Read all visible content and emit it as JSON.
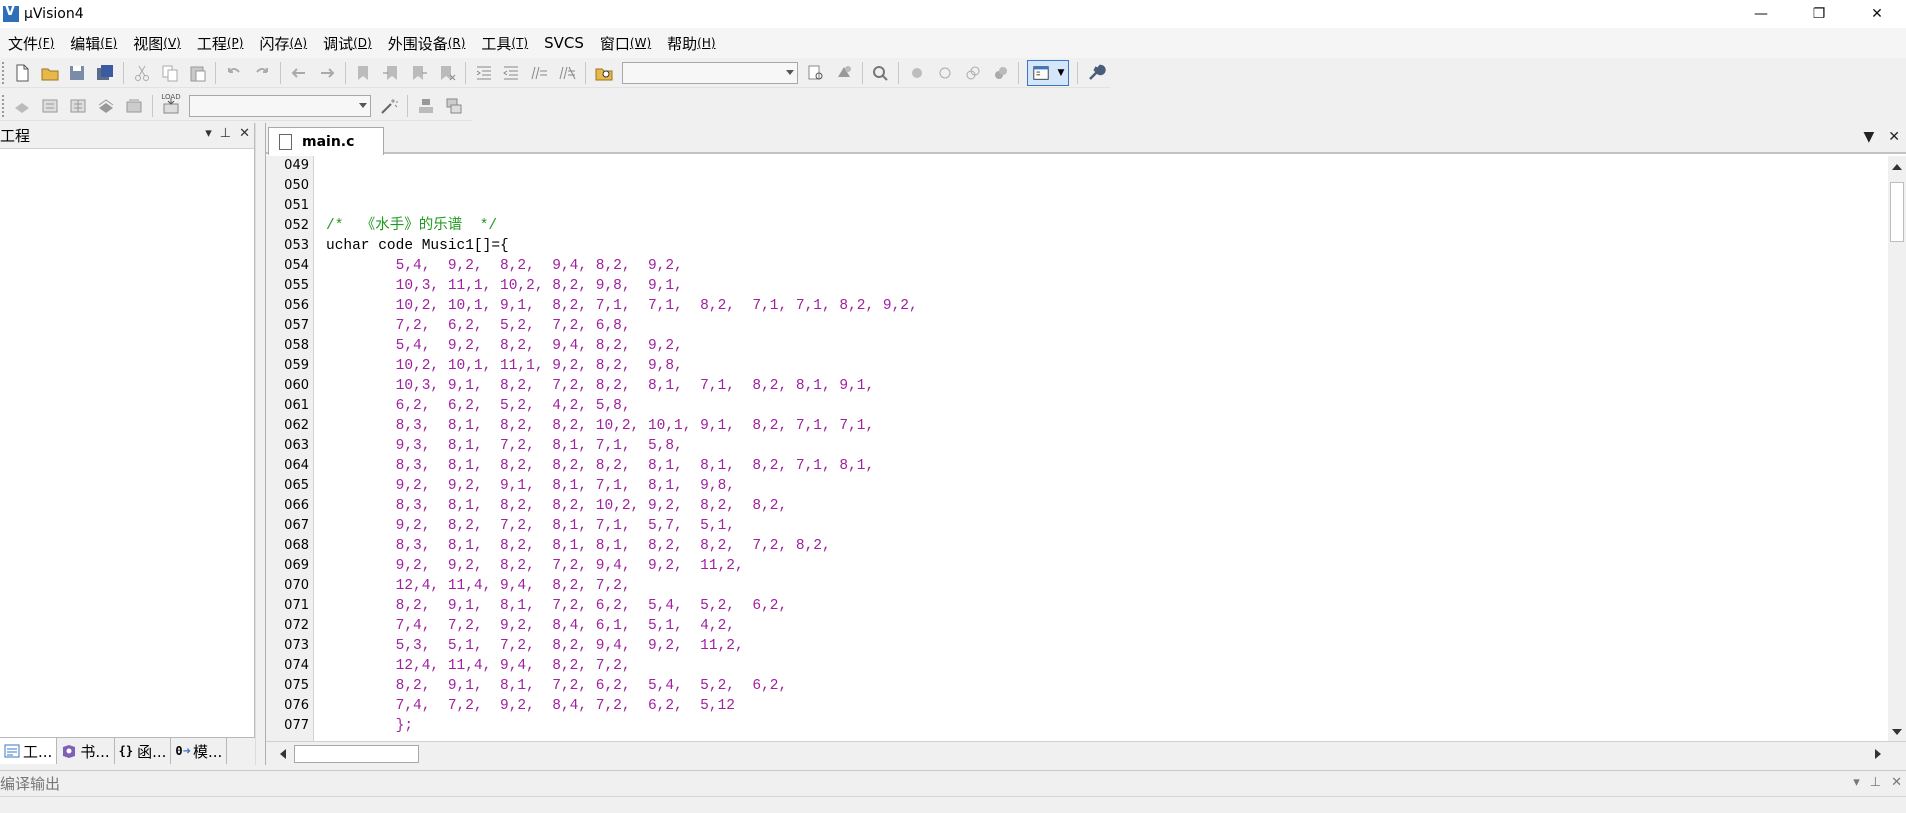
{
  "window": {
    "title": "µVision4",
    "logo_letter": "V",
    "controls": {
      "minimize": "—",
      "maximize": "❐",
      "close": "✕"
    }
  },
  "menu": [
    {
      "label": "文件",
      "accel": "(F)"
    },
    {
      "label": "编辑",
      "accel": "(E)"
    },
    {
      "label": "视图",
      "accel": "(V)"
    },
    {
      "label": "工程",
      "accel": "(P)"
    },
    {
      "label": "闪存",
      "accel": "(A)"
    },
    {
      "label": "调试",
      "accel": "(D)"
    },
    {
      "label": "外围设备",
      "accel": "(R)"
    },
    {
      "label": "工具",
      "accel": "(T)"
    },
    {
      "label": "SVCS",
      "accel": ""
    },
    {
      "label": "窗口",
      "accel": "(W)"
    },
    {
      "label": "帮助",
      "accel": "(H)"
    }
  ],
  "toolbar": {
    "target_combo_value": "",
    "target_select_value": "",
    "load_label": "LOAD"
  },
  "project_panel": {
    "title": "工程",
    "controls": {
      "dropdown": "▾",
      "pin": "⊥",
      "close": "✕"
    },
    "tabs": [
      {
        "label": "工...",
        "icon": "project-icon"
      },
      {
        "label": "书...",
        "icon": "books-icon"
      },
      {
        "label": "函...",
        "icon": "functions-icon",
        "prefix": "{}"
      },
      {
        "label": "模...",
        "icon": "templates-icon",
        "prefix": "0"
      }
    ]
  },
  "editor": {
    "active_file": "main.c",
    "controls": {
      "dropdown": "▼",
      "close": "✕"
    },
    "lines": [
      {
        "no": "049",
        "parts": []
      },
      {
        "no": "050",
        "parts": []
      },
      {
        "no": "051",
        "parts": []
      },
      {
        "no": "052",
        "parts": [
          {
            "t": "/*  《水手》的乐谱  */",
            "c": "cmt"
          }
        ]
      },
      {
        "no": "053",
        "parts": [
          {
            "t": "uchar code Music1[]={",
            "c": "kw"
          }
        ]
      },
      {
        "no": "054",
        "parts": [
          {
            "t": "        5,4,  9,2,  8,2,  9,4, 8,2,  9,2,",
            "c": "num"
          }
        ]
      },
      {
        "no": "055",
        "parts": [
          {
            "t": "        10,3, 11,1, 10,2, 8,2, 9,8,  9,1,",
            "c": "num"
          }
        ]
      },
      {
        "no": "056",
        "parts": [
          {
            "t": "        10,2, 10,1, 9,1,  8,2, 7,1,  7,1,  8,2,  7,1, 7,1, 8,2, 9,2,",
            "c": "num"
          }
        ]
      },
      {
        "no": "057",
        "parts": [
          {
            "t": "        7,2,  6,2,  5,2,  7,2, 6,8,",
            "c": "num"
          }
        ]
      },
      {
        "no": "058",
        "parts": [
          {
            "t": "        5,4,  9,2,  8,2,  9,4, 8,2,  9,2,",
            "c": "num"
          }
        ]
      },
      {
        "no": "059",
        "parts": [
          {
            "t": "        10,2, 10,1, 11,1, 9,2, 8,2,  9,8,",
            "c": "num"
          }
        ]
      },
      {
        "no": "060",
        "parts": [
          {
            "t": "        10,3, 9,1,  8,2,  7,2, 8,2,  8,1,  7,1,  8,2, 8,1, 9,1,",
            "c": "num"
          }
        ]
      },
      {
        "no": "061",
        "parts": [
          {
            "t": "        6,2,  6,2,  5,2,  4,2, 5,8,",
            "c": "num"
          }
        ]
      },
      {
        "no": "062",
        "parts": [
          {
            "t": "        8,3,  8,1,  8,2,  8,2, 10,2, 10,1, 9,1,  8,2, 7,1, 7,1,",
            "c": "num"
          }
        ]
      },
      {
        "no": "063",
        "parts": [
          {
            "t": "        9,3,  8,1,  7,2,  8,1, 7,1,  5,8,",
            "c": "num"
          }
        ]
      },
      {
        "no": "064",
        "parts": [
          {
            "t": "        8,3,  8,1,  8,2,  8,2, 8,2,  8,1,  8,1,  8,2, 7,1, 8,1,",
            "c": "num"
          }
        ]
      },
      {
        "no": "065",
        "parts": [
          {
            "t": "        9,2,  9,2,  9,1,  8,1, 7,1,  8,1,  9,8,",
            "c": "num"
          }
        ]
      },
      {
        "no": "066",
        "parts": [
          {
            "t": "        8,3,  8,1,  8,2,  8,2, 10,2, 9,2,  8,2,  8,2,",
            "c": "num"
          }
        ]
      },
      {
        "no": "067",
        "parts": [
          {
            "t": "        9,2,  8,2,  7,2,  8,1, 7,1,  5,7,  5,1,",
            "c": "num"
          }
        ]
      },
      {
        "no": "068",
        "parts": [
          {
            "t": "        8,3,  8,1,  8,2,  8,1, 8,1,  8,2,  8,2,  7,2, 8,2,",
            "c": "num"
          }
        ]
      },
      {
        "no": "069",
        "parts": [
          {
            "t": "        9,2,  9,2,  8,2,  7,2, 9,4,  9,2,  11,2,",
            "c": "num"
          }
        ]
      },
      {
        "no": "070",
        "parts": [
          {
            "t": "        12,4, 11,4, 9,4,  8,2, 7,2,",
            "c": "num"
          }
        ]
      },
      {
        "no": "071",
        "parts": [
          {
            "t": "        8,2,  9,1,  8,1,  7,2, 6,2,  5,4,  5,2,  6,2,",
            "c": "num"
          }
        ]
      },
      {
        "no": "072",
        "parts": [
          {
            "t": "        7,4,  7,2,  9,2,  8,4, 6,1,  5,1,  4,2,",
            "c": "num"
          }
        ]
      },
      {
        "no": "073",
        "parts": [
          {
            "t": "        5,3,  5,1,  7,2,  8,2, 9,4,  9,2,  11,2,",
            "c": "num"
          }
        ]
      },
      {
        "no": "074",
        "parts": [
          {
            "t": "        12,4, 11,4, 9,4,  8,2, 7,2,",
            "c": "num"
          }
        ]
      },
      {
        "no": "075",
        "parts": [
          {
            "t": "        8,2,  9,1,  8,1,  7,2, 6,2,  5,4,  5,2,  6,2,",
            "c": "num"
          }
        ]
      },
      {
        "no": "076",
        "parts": [
          {
            "t": "        7,4,  7,2,  9,2,  8,4, 7,2,  6,2,  5,12",
            "c": "num"
          }
        ]
      },
      {
        "no": "077",
        "parts": [
          {
            "t": "        };",
            "c": "num"
          }
        ]
      }
    ]
  },
  "build_output": {
    "title": "编译输出",
    "controls": {
      "dropdown": "▾",
      "pin": "⊥",
      "close": "✕"
    }
  },
  "colors": {
    "comment": "#1f9a1f",
    "number": "#a020a0",
    "keyword": "#000000",
    "accent": "#3a77c2"
  }
}
